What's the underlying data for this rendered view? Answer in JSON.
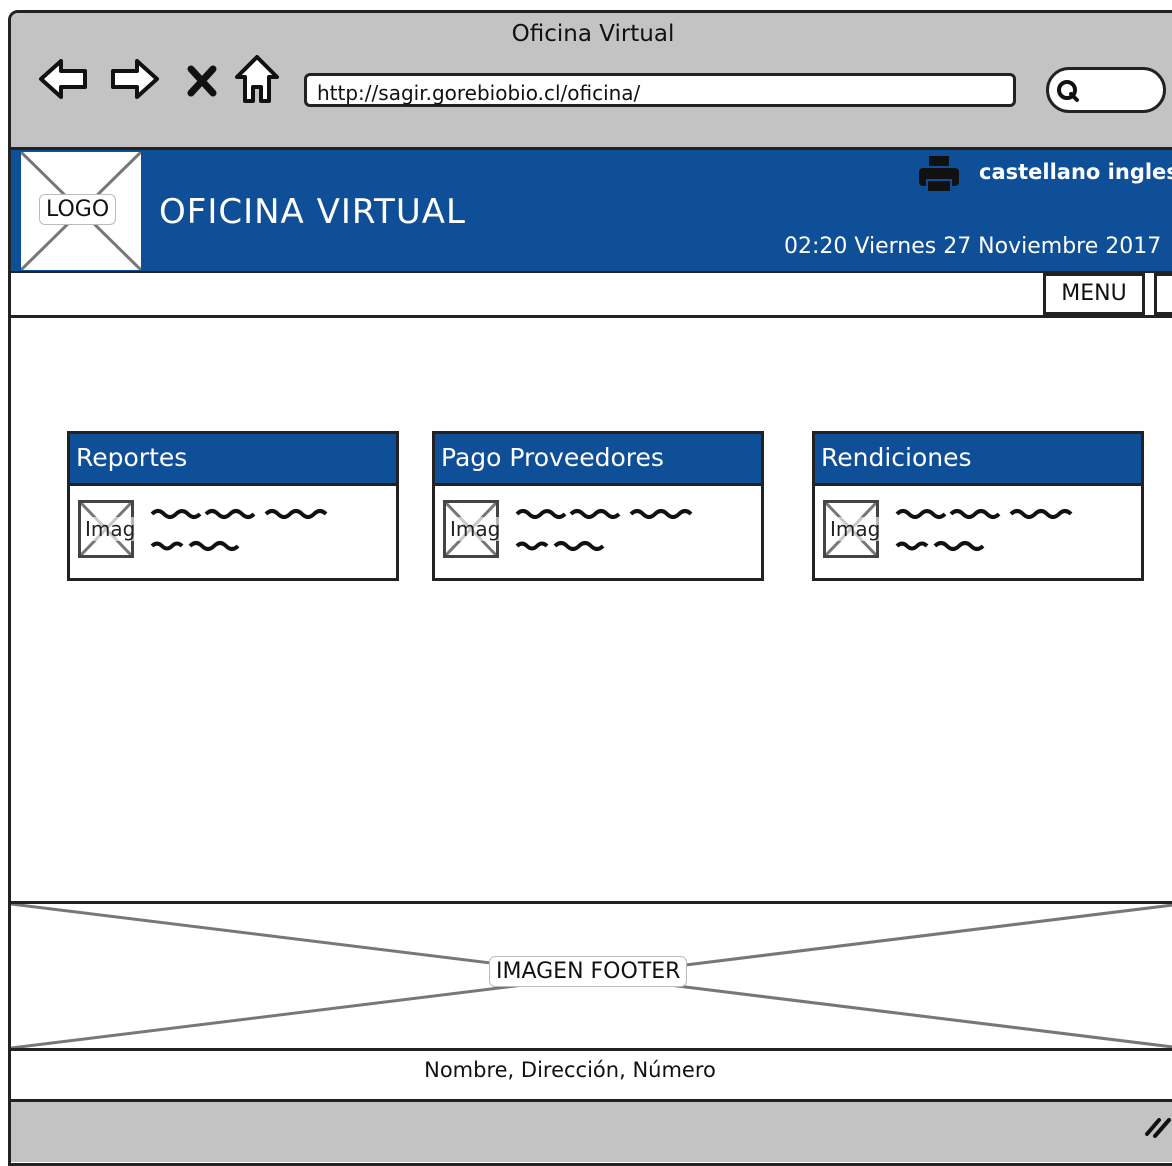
{
  "browser": {
    "window_title": "Oficina Virtual",
    "url": "http://sagir.gorebiobio.cl/oficina/"
  },
  "header": {
    "logo_label": "LOGO",
    "site_title": "OFICINA VIRTUAL",
    "languages": [
      "castellano",
      "ingles"
    ],
    "datetime": "02:20 Viernes 27 Noviembre 2017",
    "brand_color": "#0f4f97"
  },
  "menu": {
    "label": "MENU"
  },
  "cards": [
    {
      "title": "Reportes",
      "image_label": "Imag"
    },
    {
      "title": "Pago Proveedores",
      "image_label": "Imag"
    },
    {
      "title": "Rendiciones",
      "image_label": "Imag"
    }
  ],
  "footer": {
    "image_label": "IMAGEN FOOTER",
    "info": "Nombre, Dirección, Número"
  }
}
